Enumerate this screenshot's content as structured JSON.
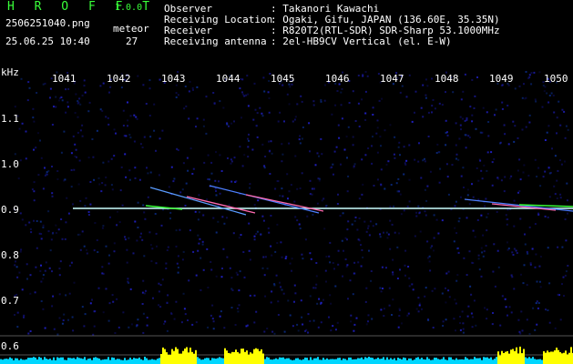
{
  "header": {
    "brand": "H R O F F T",
    "version": "1.0.0",
    "filename": "2506251040.png",
    "datetime": "25.06.25 10:40",
    "meteor_label": "meteor",
    "meteor_count": "27"
  },
  "info": [
    {
      "key": "Observer",
      "value": ": Takanori Kawachi"
    },
    {
      "key": "Receiving Location",
      "value": ": Ogaki, Gifu, JAPAN (136.60E, 35.35N)"
    },
    {
      "key": "Receiver",
      "value": ": R820T2(RTL-SDR) SDR-Sharp 53.1000MHz"
    },
    {
      "key": "Receiving antenna",
      "value": ": 2el-HB9CV Vertical (el. E-W)"
    }
  ],
  "axis": {
    "freq_unit": "kHz",
    "x_ticks": [
      "1041",
      "1042",
      "1043",
      "1044",
      "1045",
      "1046",
      "1047",
      "1048",
      "1049",
      "1050"
    ],
    "y_ticks": [
      "1.1",
      "1.0",
      "0.9",
      "0.8",
      "0.7",
      "0.6"
    ]
  },
  "colors": {
    "label_green": "#39ff39",
    "carrier": "#ffffff",
    "noise_bg": "#0a0a3a",
    "spectrum_fill": "#00d6ff",
    "spectrum_peak": "#ffff00"
  }
}
